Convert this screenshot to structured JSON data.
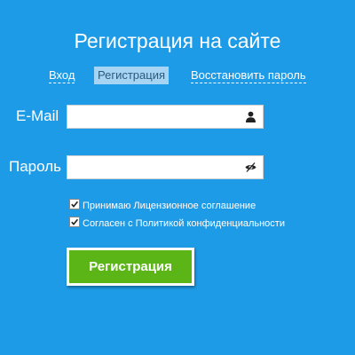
{
  "page": {
    "title": "Регистрация на сайте"
  },
  "tabs": {
    "login": "Вход",
    "register": "Регистрация",
    "restore": "Восстановить пароль",
    "active": "register"
  },
  "form": {
    "email": {
      "label": "E-Mail",
      "value": "",
      "icon": "user-icon"
    },
    "password": {
      "label": "Пароль",
      "value": "",
      "icon": "eye-icon"
    },
    "checkboxes": [
      {
        "label": "Принимаю Лицензионное соглашение",
        "checked": true
      },
      {
        "label": "Согласен с Политикой конфиденциальности",
        "checked": true
      }
    ],
    "submit_label": "Регистрация"
  },
  "colors": {
    "background": "#1e9be6",
    "submit": "#5bb516",
    "active_tab_bg": "#a7d4f3"
  }
}
